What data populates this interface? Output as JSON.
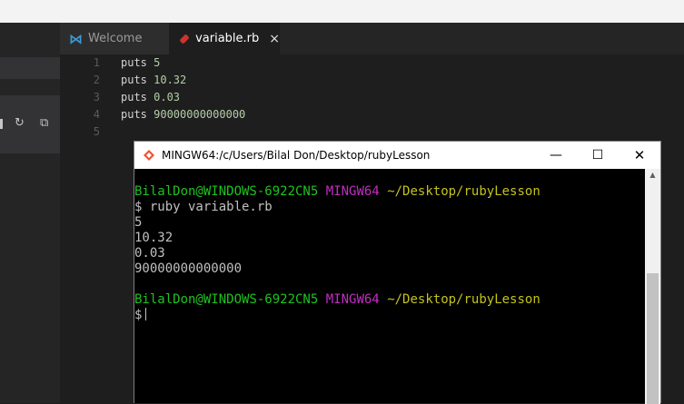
{
  "tabs": [
    {
      "label": "Welcome",
      "icon": "vscode-icon"
    },
    {
      "label": "variable.rb",
      "icon": "ruby-file-icon",
      "close": "×"
    }
  ],
  "editor": {
    "line_numbers": [
      "1",
      "2",
      "3",
      "4",
      "5"
    ],
    "lines": [
      {
        "kw": "puts ",
        "num": "5"
      },
      {
        "kw": "puts ",
        "num": "10.32"
      },
      {
        "kw": "puts ",
        "num": "0.03"
      },
      {
        "kw": "puts ",
        "num": "90000000000000"
      },
      {
        "kw": "",
        "num": ""
      }
    ]
  },
  "terminal": {
    "title": "MINGW64:/c/Users/Bilal Don/Desktop/rubyLesson",
    "prompt_user": "BilalDon@WINDOWS-6922CN5",
    "prompt_env": "MINGW64",
    "prompt_path": "~/Desktop/rubyLesson",
    "command": "$ ruby variable.rb",
    "output": [
      "5",
      "10.32",
      "0.03",
      "90000000000000"
    ],
    "prompt_symbol": "$",
    "controls": {
      "minimize": "—",
      "maximize": "☐",
      "close": "✕"
    }
  },
  "colors": {
    "editor_bg": "#1e1e1e",
    "number": "#b5cea8",
    "prompt_green": "#1fc21f",
    "prompt_magenta": "#c22ec2",
    "prompt_yellow": "#c2c21f"
  }
}
